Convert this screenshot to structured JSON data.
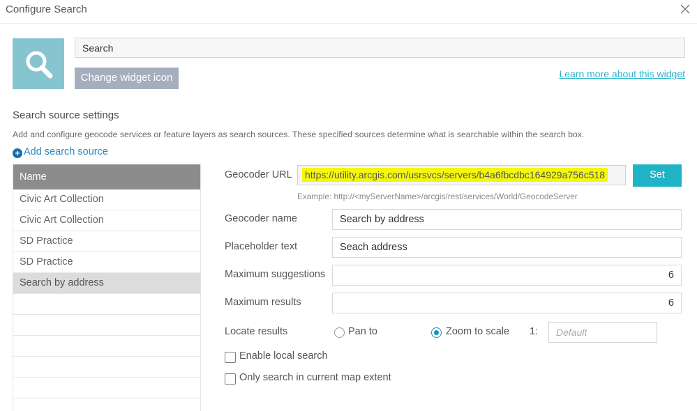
{
  "dialog": {
    "title": "Configure Search"
  },
  "widget": {
    "name": "Search",
    "change_icon_label": "Change widget icon",
    "learn_more_label": "Learn more about this widget"
  },
  "sources_section": {
    "title": "Search source settings",
    "description": "Add and configure geocode services or feature layers as search sources. These specified sources determine what is searchable within the search box.",
    "add_label": "Add search source",
    "table": {
      "header": "Name",
      "rows": [
        "Civic Art Collection",
        "Civic Art Collection",
        "SD Practice",
        "SD Practice",
        "Search by address"
      ],
      "selected": "Search by address"
    }
  },
  "settings": {
    "geocoder_url": {
      "label": "Geocoder URL",
      "value": "https://utility.arcgis.com/usrsvcs/servers/b4a6fbcdbc164929a756c518",
      "example": "Example: http://<myServerName>/arcgis/rest/services/World/GeocodeServer",
      "set_label": "Set"
    },
    "geocoder_name": {
      "label": "Geocoder name",
      "value": "Search by address"
    },
    "placeholder_text": {
      "label": "Placeholder text",
      "value": "Seach address"
    },
    "max_suggestions": {
      "label": "Maximum suggestions",
      "value": "6"
    },
    "max_results": {
      "label": "Maximum results",
      "value": "6"
    },
    "locate_results": {
      "label": "Locate results",
      "pan_label": "Pan to",
      "zoom_label": "Zoom to scale",
      "selected": "zoom",
      "scale_prefix": "1:",
      "scale_placeholder": "Default"
    },
    "enable_local_search": {
      "label": "Enable local search",
      "checked": false
    },
    "only_current_extent": {
      "label": "Only search in current map extent",
      "checked": false
    }
  },
  "colors": {
    "icon_tile": "#86c5cf",
    "accent": "#20b2c6",
    "highlight": "#f4f70e",
    "header_gray": "#8c8c8c"
  },
  "icons": [
    "close-icon",
    "search-icon",
    "plus-circle-icon"
  ]
}
